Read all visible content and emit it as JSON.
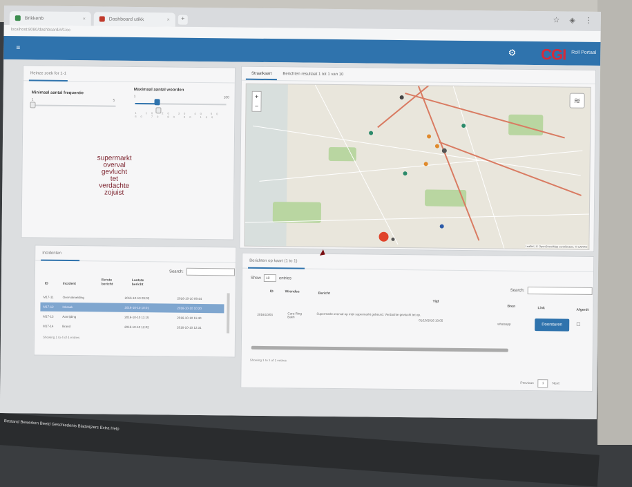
{
  "browser": {
    "tabs": [
      {
        "label": "Brikkenb"
      },
      {
        "label": "Dashboard utikk"
      }
    ],
    "new_tab": "+",
    "icons": [
      "star-icon",
      "extension-icon",
      "menu-icon"
    ],
    "address": "localhost:8080/dashboard/#/1/cc"
  },
  "appbar": {
    "menu_icon": "≡",
    "logo": "CGI",
    "user": "Roll Portaal"
  },
  "filters": {
    "tab": "Heinze zoek for 1-1",
    "slider1": {
      "label": "Minimaal aantal frequentie",
      "min": "1",
      "max": "5",
      "value_fraction": 0.0
    },
    "slider2": {
      "label": "Maximaal aantal woorden",
      "min": "1",
      "max": "100",
      "value_fraction": 0.22
    },
    "ticks": "1 10 20 30 40 50 60 70 80 90 100"
  },
  "wordcloud": [
    "supermarkt",
    "overval",
    "gevlucht",
    "tet",
    "verdachte",
    "zojuist"
  ],
  "maptabs": {
    "active": "Straatkaart",
    "other": "Berichten resultaat 1 tot 1 van 10"
  },
  "map": {
    "zoom_in": "+",
    "zoom_out": "−",
    "attribution": "Leaflet | © OpenStreetMap contributors, © CARTO"
  },
  "left_table": {
    "tab": "Incidenten",
    "search_label": "Search:",
    "headers": [
      "ID",
      "Incident",
      "Eerste bericht",
      "Laatste bericht"
    ],
    "rows": [
      [
        "M17-11",
        "Overvalmelding",
        "2016-10-10 09:05",
        "2016-10-10 09:44"
      ],
      [
        "M17-12",
        "Inbraak",
        "2016-10-10 10:01",
        "2016-10-10 10:20"
      ],
      [
        "M17-13",
        "Aanrijding",
        "2016-10-10 11:15",
        "2016-10-10 11:40"
      ],
      [
        "M17-14",
        "Brand",
        "2016-10-10 12:02",
        "2016-10-10 12:31"
      ]
    ],
    "info": "Showing 1 to 4 of 4 entries"
  },
  "right_table": {
    "tab": "Berichten op kaart (1 to 1)",
    "show_label": "Show",
    "show_value": "10",
    "entries_label": "entries",
    "search_label": "Search:",
    "headers": [
      "ID",
      "Wrendes",
      "Bericht",
      "Tijd",
      "Bron",
      "Link",
      "Afgerdt"
    ],
    "row": {
      "id": "2016/10/03",
      "who": "Cara-Ring Bakh",
      "msg": "Supermarkt overval op mijn supermarkt gebeurd. Verdachte gevlucht tet op.",
      "time": "01/10/2016 10:05",
      "src": "whatsapp",
      "button": "Doorsturen",
      "check": "☐"
    },
    "info": "Showing 1 to 1 of 1 entries",
    "pagination": {
      "prev": "Previous",
      "page": "1",
      "next": "Next"
    }
  },
  "taskbar": "Bestand  Bewerken  Beeld  Geschiedenis  Bladwijzers  Extra  Help"
}
